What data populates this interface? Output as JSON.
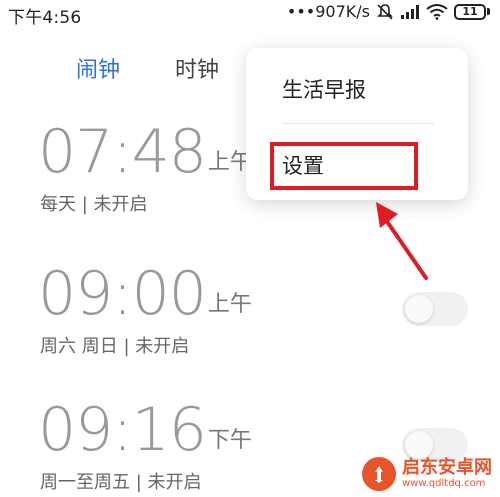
{
  "status_bar": {
    "time": "下午4:56",
    "network_speed": "•••907K/s",
    "battery_level": "11",
    "icons": [
      "mute-icon",
      "signal-icon",
      "wifi-icon",
      "battery-icon"
    ]
  },
  "tabs": [
    {
      "label": "闹钟",
      "active": true
    },
    {
      "label": "时钟",
      "active": false
    }
  ],
  "alarms": [
    {
      "time": "07:48",
      "ampm": "上午",
      "repeat": "每天",
      "status": "未开启",
      "separator": "|"
    },
    {
      "time": "09:00",
      "ampm": "上午",
      "repeat": "周六 周日",
      "status": "未开启",
      "separator": "|"
    },
    {
      "time": "09:16",
      "ampm": "下午",
      "repeat": "周一至周五",
      "status": "未开启",
      "separator": "|"
    }
  ],
  "popup_menu": {
    "items": [
      {
        "label": "生活早报"
      },
      {
        "label": "设置",
        "highlighted": true
      }
    ]
  },
  "watermark": {
    "title": "启东安卓网",
    "url": "www.qdltdq.com"
  },
  "colors": {
    "accent": "#2f6fe0",
    "highlight": "#e01b24",
    "watermark": "#e8532b"
  }
}
